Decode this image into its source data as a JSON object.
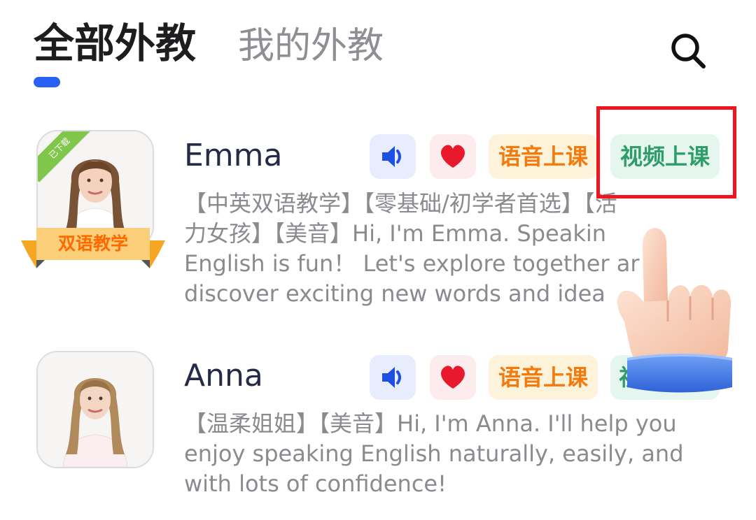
{
  "tabs": [
    {
      "label": "全部外教",
      "active": true
    },
    {
      "label": "我的外教",
      "active": false
    }
  ],
  "search_icon": "search-icon",
  "teachers": [
    {
      "name": "Emma",
      "corner_badge": "已下载",
      "ribbon": "双语教学",
      "sound_icon": "speaker-icon",
      "favorite_icon": "heart-icon",
      "voice_label": "语音上课",
      "video_label": "视频上课",
      "description": "【中英双语教学】【零基础/初学者首选】【活\n力女孩】【美音】Hi, I'm Emma. Speakin\nEnglish is fun！ Let's explore together ar\ndiscover exciting new words and idea"
    },
    {
      "name": "Anna",
      "sound_icon": "speaker-icon",
      "favorite_icon": "heart-icon",
      "voice_label": "语音上课",
      "video_label": "视",
      "description": "【温柔姐姐】【美音】Hi, I'm Anna. I'll help you\nenjoy speaking English naturally, easily, and\nwith lots of confidence!"
    }
  ],
  "colors": {
    "accent": "#2a61f5",
    "voice": "#f37a0c",
    "video": "#2e9d6a",
    "highlight": "#f0141e"
  }
}
